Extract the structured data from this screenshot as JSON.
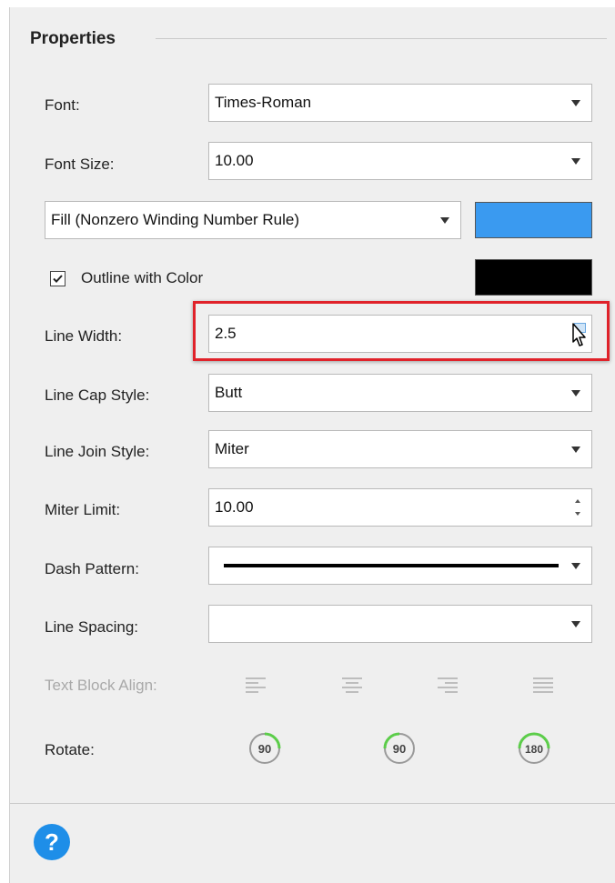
{
  "panel": {
    "title": "Properties"
  },
  "font": {
    "label": "Font:",
    "value": "Times-Roman"
  },
  "font_size": {
    "label": "Font Size:",
    "value": "10.00"
  },
  "fill": {
    "value": "Fill (Nonzero Winding Number Rule)",
    "color": "#3a9af0"
  },
  "outline": {
    "label": "Outline with Color",
    "checked": true,
    "color": "#000000"
  },
  "line_width": {
    "label": "Line Width:",
    "value": "2.5"
  },
  "line_cap": {
    "label": "Line Cap Style:",
    "value": "Butt"
  },
  "line_join": {
    "label": "Line Join Style:",
    "value": "Miter"
  },
  "miter_limit": {
    "label": "Miter Limit:",
    "value": "10.00"
  },
  "dash_pattern": {
    "label": "Dash Pattern:"
  },
  "line_spacing": {
    "label": "Line Spacing:",
    "value": ""
  },
  "text_block_align": {
    "label": "Text Block Align:",
    "options": [
      "align-left-icon",
      "align-center-icon",
      "align-right-icon",
      "align-justify-icon"
    ]
  },
  "rotate": {
    "label": "Rotate:",
    "buttons": [
      "90",
      "90",
      "180"
    ]
  },
  "help": {
    "label": "?"
  },
  "colors": {
    "highlight": "#e0222a",
    "accent": "#1e8ee8",
    "rotate_arc": "#5ccd4a"
  }
}
